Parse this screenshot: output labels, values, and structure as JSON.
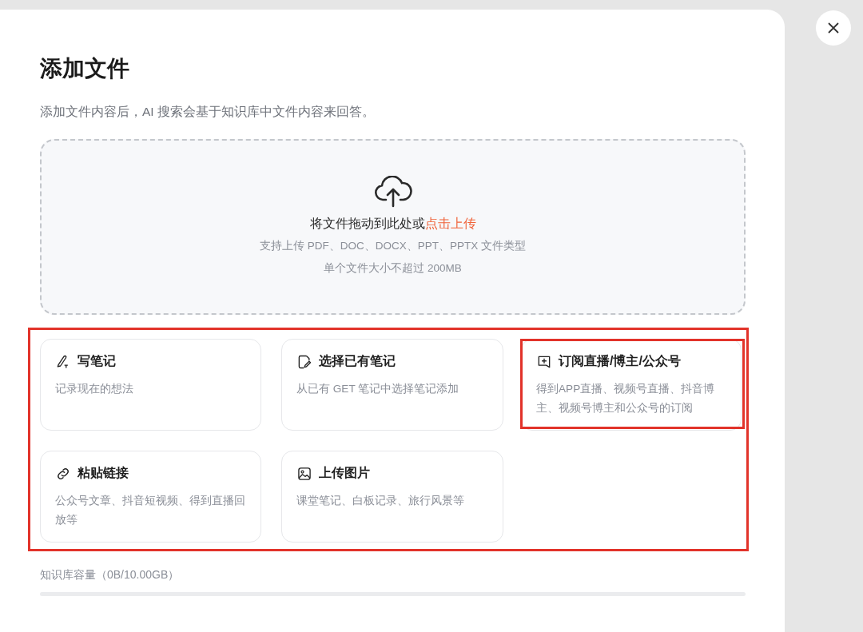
{
  "dialog": {
    "title": "添加文件",
    "subtitle": "添加文件内容后，AI 搜索会基于知识库中文件内容来回答。"
  },
  "dropzone": {
    "prompt": "将文件拖动到此处或",
    "link": "点击上传",
    "formats": "支持上传 PDF、DOC、DOCX、PPT、PPTX 文件类型",
    "limit": "单个文件大小不超过 200MB"
  },
  "options_highlighted": true,
  "options": [
    {
      "kind": "pen",
      "title": "写笔记",
      "description": "记录现在的想法",
      "highlighted": false
    },
    {
      "kind": "note",
      "title": "选择已有笔记",
      "description": "从已有 GET 笔记中选择笔记添加",
      "highlighted": false
    },
    {
      "kind": "subscribe",
      "title": "订阅直播/博主/公众号",
      "description": "得到APP直播、视频号直播、抖音博主、视频号博主和公众号的订阅",
      "highlighted": true
    },
    {
      "kind": "link",
      "title": "粘贴链接",
      "description": "公众号文章、抖音短视频、得到直播回放等",
      "highlighted": false
    },
    {
      "kind": "image",
      "title": "上传图片",
      "description": "课堂笔记、白板记录、旅行风景等",
      "highlighted": false
    }
  ],
  "capacity": {
    "label": "知识库容量（0B/10.00GB）",
    "level": 0
  }
}
